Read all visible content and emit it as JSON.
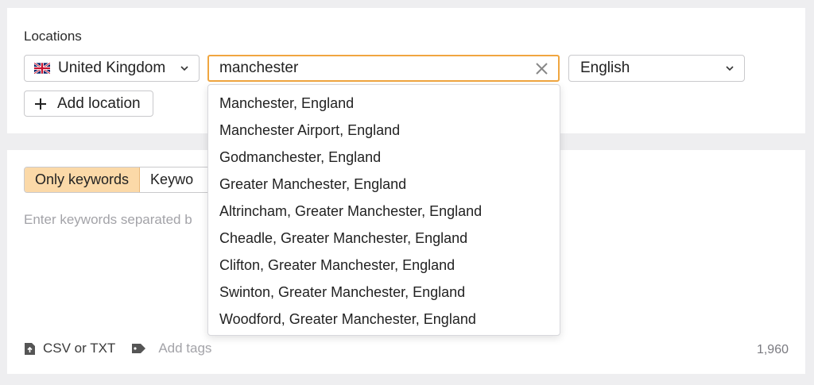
{
  "locations": {
    "label": "Locations",
    "country": {
      "name": "United Kingdom",
      "flag_icon": "uk-flag-icon"
    },
    "search": {
      "value": "manchester"
    },
    "language": {
      "value": "English"
    },
    "add_location_label": "Add location"
  },
  "suggestions": [
    "Manchester, England",
    "Manchester Airport, England",
    "Godmanchester, England",
    "Greater Manchester, England",
    "Altrincham, Greater Manchester, England",
    "Cheadle, Greater Manchester, England",
    "Clifton, Greater Manchester, England",
    "Swinton, Greater Manchester, England",
    "Woodford, Greater Manchester, England"
  ],
  "keywords": {
    "tabs": [
      "Only keywords",
      "Keywo"
    ],
    "placeholder": "Enter keywords separated b",
    "upload_label": "CSV or TXT",
    "tags_label": "Add tags",
    "char_count": "1,960"
  },
  "colors": {
    "accent": "#f0a640",
    "active_tab": "#fbd9a8",
    "background": "#eeeef0"
  }
}
